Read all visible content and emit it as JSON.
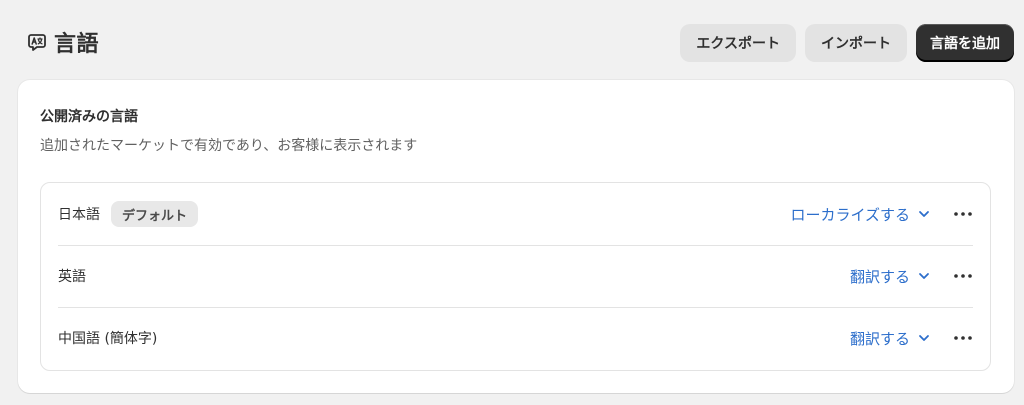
{
  "header": {
    "title": "言語",
    "icon": "translate-icon",
    "export_label": "エクスポート",
    "import_label": "インポート",
    "add_label": "言語を追加"
  },
  "published": {
    "title": "公開済みの言語",
    "description": "追加されたマーケットで有効であり、お客様に表示されます",
    "languages": [
      {
        "name": "日本語",
        "badge": "デフォルト",
        "action": "ローカライズする"
      },
      {
        "name": "英語",
        "action": "翻訳する"
      },
      {
        "name": "中国語 (簡体字)",
        "action": "翻訳する"
      }
    ]
  },
  "colors": {
    "accent": "#2c6ecb",
    "primary_button": "#303030",
    "background": "#f1f1f1"
  }
}
